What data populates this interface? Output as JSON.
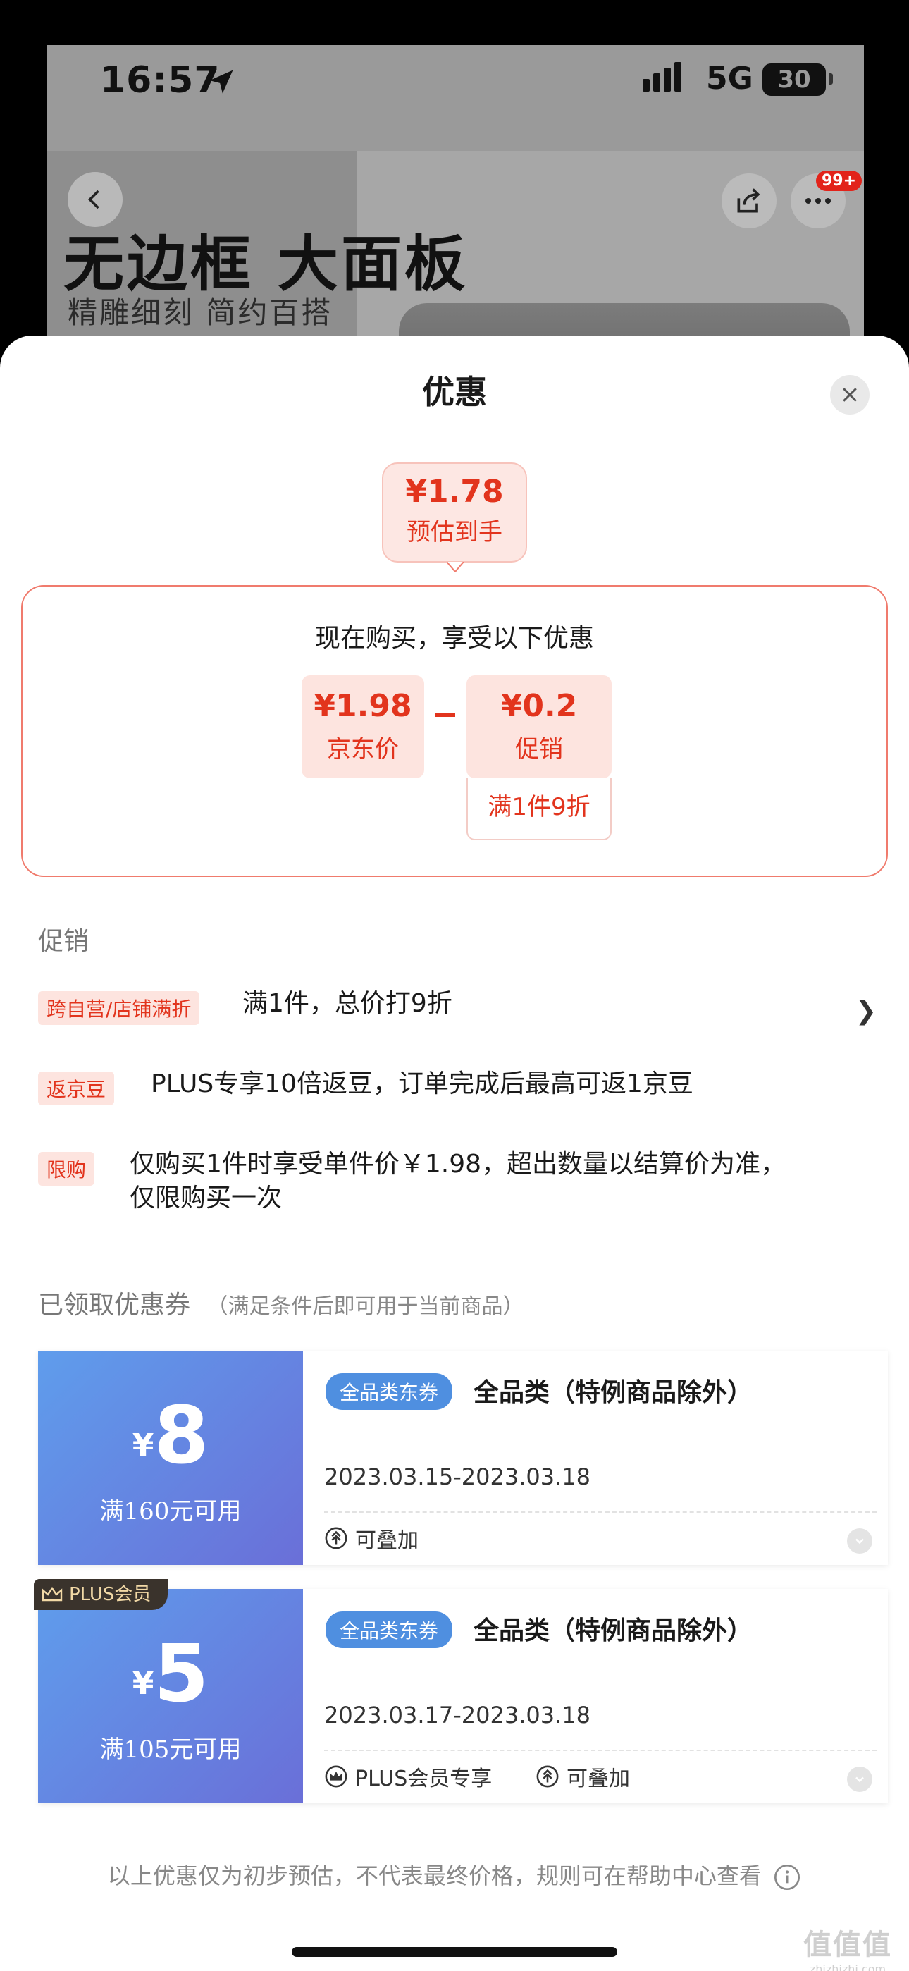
{
  "status_bar": {
    "time": "16:57",
    "network": "5G",
    "battery": "30"
  },
  "background_page": {
    "banner_title": "无边框 大面板",
    "banner_subtitle": "精雕细刻 简约百搭",
    "notification_badge": "99+"
  },
  "sheet": {
    "title": "优惠",
    "estimate": {
      "price": "¥1.78",
      "label": "预估到手"
    },
    "calc": {
      "heading": "现在购买，享受以下优惠",
      "jd_price": {
        "value": "¥1.98",
        "label": "京东价"
      },
      "operator": "-",
      "promotion": {
        "value": "¥0.2",
        "label": "促销",
        "detail": "满1件9折"
      }
    },
    "promotions": {
      "section_title": "促销",
      "items": [
        {
          "tag": "跨自营/店铺满折",
          "text": "满1件，总价打9折"
        },
        {
          "tag": "返京豆",
          "text": "PLUS专享10倍返豆，订单完成后最高可返1京豆"
        },
        {
          "tag": "限购",
          "text": "仅购买1件时享受单件价￥1.98，超出数量以结算价为准，仅限购买一次"
        }
      ]
    },
    "coupons": {
      "section_title": "已领取优惠券",
      "section_note": "（满足条件后即可用于当前商品）",
      "items": [
        {
          "currency": "¥",
          "amount": "8",
          "condition": "满160元可用",
          "tag": "全品类东券",
          "title": "全品类（特例商品除外）",
          "date": "2023.03.15-2023.03.18",
          "stackable": "可叠加"
        },
        {
          "badge": "PLUS会员",
          "currency": "¥",
          "amount": "5",
          "condition": "满105元可用",
          "tag": "全品类东券",
          "title": "全品类（特例商品除外）",
          "date": "2023.03.17-2023.03.18",
          "member_only": "PLUS会员专享",
          "stackable": "可叠加"
        }
      ]
    },
    "footer_note": "以上优惠仅为初步预估，不代表最终价格，规则可在帮助中心查看",
    "watermark": {
      "main": "值值值",
      "sub": "zhizhizhi.com"
    }
  },
  "colors": {
    "accent_red": "#e2341d",
    "coupon_blue": "#5f9dec",
    "coupon_purple": "#6a6fd8"
  }
}
